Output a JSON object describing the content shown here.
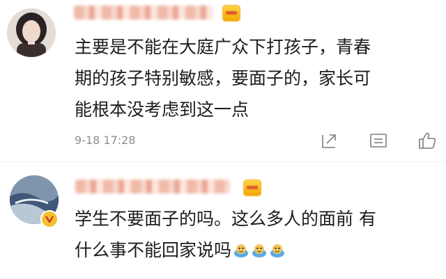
{
  "comments": [
    {
      "author": "",
      "text_lines": [
        "主要是不能在大庭广众下打孩子，青春",
        "期的孩子特别敏感，要面子的，家长可",
        "能根本没考虑到这一点"
      ],
      "time": "9-18 17:28",
      "actions": [
        "share-icon",
        "comment-icon",
        "like-icon"
      ]
    },
    {
      "author": "",
      "text_lines": [
        "学生不要面子的吗。这么多人的面前  有",
        "什么事不能回家说吗"
      ],
      "emojis": [
        "doge-icon",
        "doge-icon",
        "doge-icon"
      ]
    }
  ],
  "colors": {
    "text": "#1c1c1c",
    "timestamp": "#8d8d8d",
    "vip_badge": "#f2a500",
    "verified_badge": "#f4c12d"
  }
}
